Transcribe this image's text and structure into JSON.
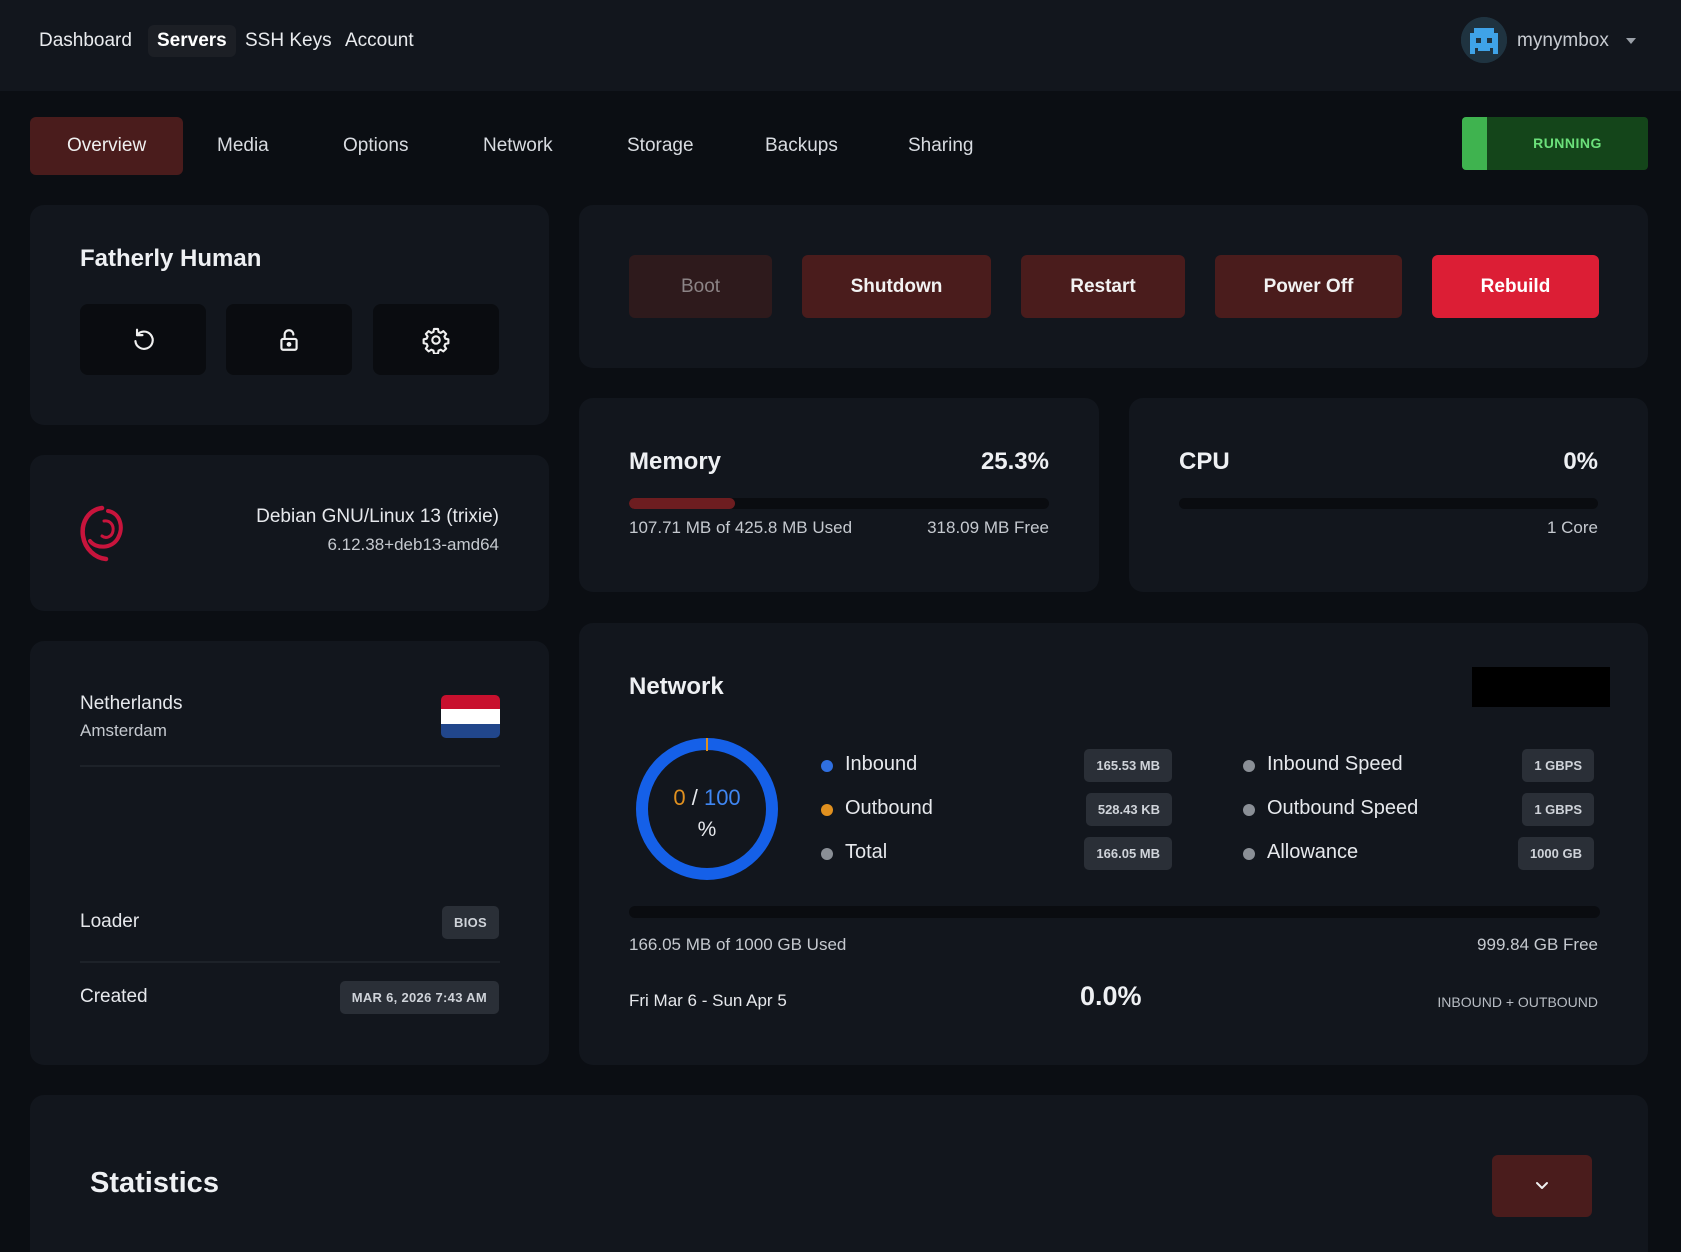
{
  "topnav": {
    "links": [
      "Dashboard",
      "Servers",
      "SSH Keys",
      "Account"
    ],
    "active": "Servers",
    "username": "mynymbox"
  },
  "tabs": [
    "Overview",
    "Media",
    "Options",
    "Network",
    "Storage",
    "Backups",
    "Sharing"
  ],
  "status": "RUNNING",
  "server": {
    "name": "Fatherly Human",
    "icons": [
      "refresh-icon",
      "lock-icon",
      "gear-icon"
    ]
  },
  "os": {
    "name": "Debian GNU/Linux 13 (trixie)",
    "kernel": "6.12.38+deb13-amd64",
    "icon": "debian-logo-icon"
  },
  "location": {
    "country": "Netherlands",
    "city": "Amsterdam",
    "flag": "netherlands-flag",
    "loader_label": "Loader",
    "loader_value": "BIOS",
    "created_label": "Created",
    "created_value": "MAR 6, 2026 7:43 AM"
  },
  "power": {
    "boot": "Boot",
    "shutdown": "Shutdown",
    "restart": "Restart",
    "poweroff": "Power Off",
    "rebuild": "Rebuild"
  },
  "memory": {
    "title": "Memory",
    "percent": "25.3%",
    "fill": 0.253,
    "used": "107.71 MB of 425.8 MB Used",
    "free": "318.09 MB Free"
  },
  "cpu": {
    "title": "CPU",
    "percent": "0%",
    "fill": 0,
    "cores": "1 Core"
  },
  "network": {
    "title": "Network",
    "gauge_current": "0",
    "gauge_sep": "/",
    "gauge_max": "100",
    "gauge_unit": "%",
    "legend": [
      {
        "label": "Inbound",
        "value": "165.53 MB",
        "color": "#2f6fe0"
      },
      {
        "label": "Outbound",
        "value": "528.43 KB",
        "color": "#e0901f"
      },
      {
        "label": "Total",
        "value": "166.05 MB",
        "color": "#8a8f96"
      }
    ],
    "specs": [
      {
        "label": "Inbound Speed",
        "value": "1 GBPS"
      },
      {
        "label": "Outbound Speed",
        "value": "1 GBPS"
      },
      {
        "label": "Allowance",
        "value": "1000 GB"
      }
    ],
    "used": "166.05 MB of 1000 GB Used",
    "free": "999.84 GB Free",
    "period": "Fri Mar 6 - Sun Apr 5",
    "period_percent": "0.0%",
    "direction": "INBOUND + OUTBOUND"
  },
  "statistics": {
    "title": "Statistics"
  },
  "colors": {
    "accent": "#4a1c1c",
    "danger": "#dc1e35",
    "running": "#6be07a",
    "gauge": "#1560e8"
  }
}
